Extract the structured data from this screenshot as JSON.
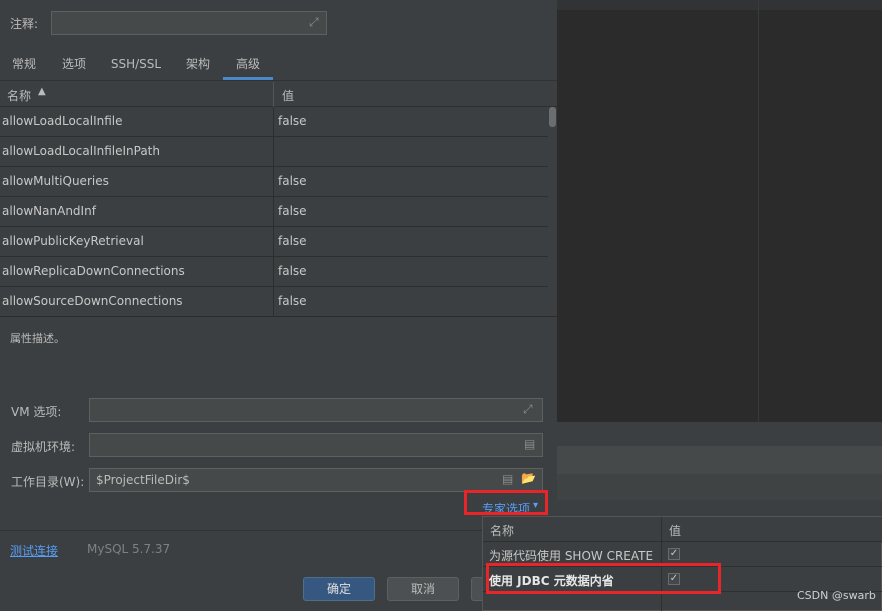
{
  "comment": {
    "label": "注释:",
    "value": ""
  },
  "tabs": [
    {
      "label": "常规",
      "active": false
    },
    {
      "label": "选项",
      "active": false
    },
    {
      "label": "SSH/SSL",
      "active": false
    },
    {
      "label": "架构",
      "active": false
    },
    {
      "label": "高级",
      "active": true
    }
  ],
  "grid": {
    "columns": [
      "名称",
      "值"
    ],
    "rows": [
      {
        "name": "allowLoadLocalInfile",
        "value": "false"
      },
      {
        "name": "allowLoadLocalInfileInPath",
        "value": ""
      },
      {
        "name": "allowMultiQueries",
        "value": "false"
      },
      {
        "name": "allowNanAndInf",
        "value": "false"
      },
      {
        "name": "allowPublicKeyRetrieval",
        "value": "false"
      },
      {
        "name": "allowReplicaDownConnections",
        "value": "false"
      },
      {
        "name": "allowSourceDownConnections",
        "value": "false"
      }
    ]
  },
  "description": "属性描述。",
  "vm_options": {
    "label": "VM 选项:",
    "value": ""
  },
  "vm_env": {
    "label": "虚拟机环境:",
    "value": ""
  },
  "work_dir": {
    "label": "工作目录(W):",
    "value": "$ProjectFileDir$"
  },
  "expert_options": {
    "label": "专家选项"
  },
  "footer": {
    "test_connection": "测试连接",
    "driver_version": "MySQL 5.7.37",
    "ok": "确定",
    "cancel": "取消"
  },
  "popup": {
    "columns": [
      "名称",
      "值"
    ],
    "rows": [
      {
        "name": "为源代码使用 SHOW CREATE",
        "checked": true
      },
      {
        "name": "使用 JDBC 元数据内省",
        "checked": true
      }
    ]
  },
  "watermark": "CSDN @swarb",
  "colors": {
    "accent": "#4a88c7",
    "highlight": "#e8262a",
    "link": "#589df6"
  },
  "icons": [
    "expand-icon",
    "sort-asc-icon",
    "document-icon",
    "folder-icon",
    "chevron-down-icon",
    "checkmark-icon"
  ]
}
